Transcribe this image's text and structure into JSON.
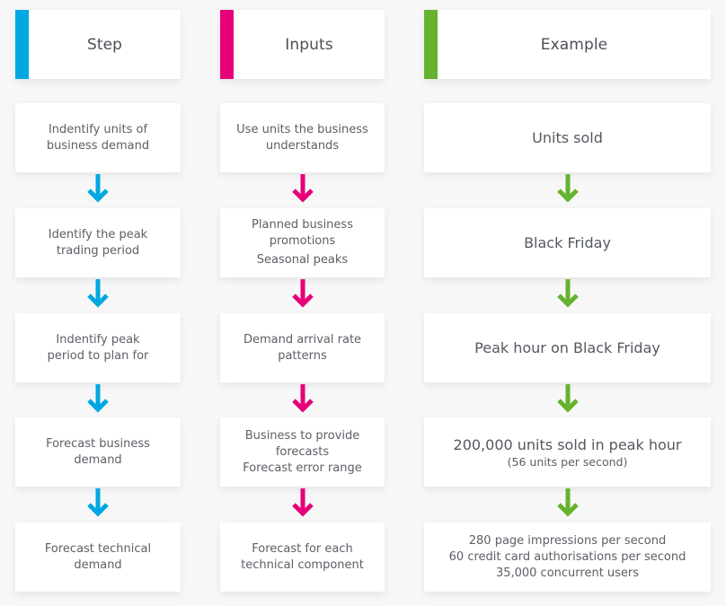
{
  "colors": {
    "step": "#00a8e2",
    "inputs": "#e6007a",
    "example": "#65b22e",
    "background": "#f7f7f7",
    "card": "#ffffff",
    "text": "#555a5f"
  },
  "columns": {
    "step": {
      "title": "Step",
      "arrow_icon": "arrow-down-icon",
      "rows": [
        {
          "lines": [
            "Indentify units of",
            "business demand"
          ]
        },
        {
          "lines": [
            "Identify the peak",
            "trading period"
          ]
        },
        {
          "lines": [
            "Indentify peak",
            "period to plan for"
          ]
        },
        {
          "lines": [
            "Forecast business",
            "demand"
          ]
        },
        {
          "lines": [
            "Forecast technical",
            "demand"
          ]
        }
      ]
    },
    "inputs": {
      "title": "Inputs",
      "arrow_icon": "arrow-down-icon",
      "rows": [
        {
          "lines": [
            "Use units the business",
            "understands"
          ]
        },
        {
          "lines": [
            "Planned business",
            "promotions",
            "Seasonal peaks"
          ]
        },
        {
          "lines": [
            "Demand arrival rate",
            "patterns"
          ]
        },
        {
          "lines": [
            "Business to provide",
            "forecasts",
            "Forecast error range"
          ]
        },
        {
          "lines": [
            "Forecast for each",
            "technical component"
          ]
        }
      ]
    },
    "example": {
      "title": "Example",
      "arrow_icon": "arrow-down-icon",
      "rows": [
        {
          "lines": [
            "Units sold"
          ]
        },
        {
          "lines": [
            "Black Friday"
          ]
        },
        {
          "lines": [
            "Peak hour on Black Friday"
          ]
        },
        {
          "lines": [
            "200,000 units sold in peak hour",
            "(56 units per second)"
          ]
        },
        {
          "lines": [
            "280 page impressions per second",
            "60 credit card authorisations per second",
            "35,000 concurrent users"
          ]
        }
      ]
    }
  }
}
